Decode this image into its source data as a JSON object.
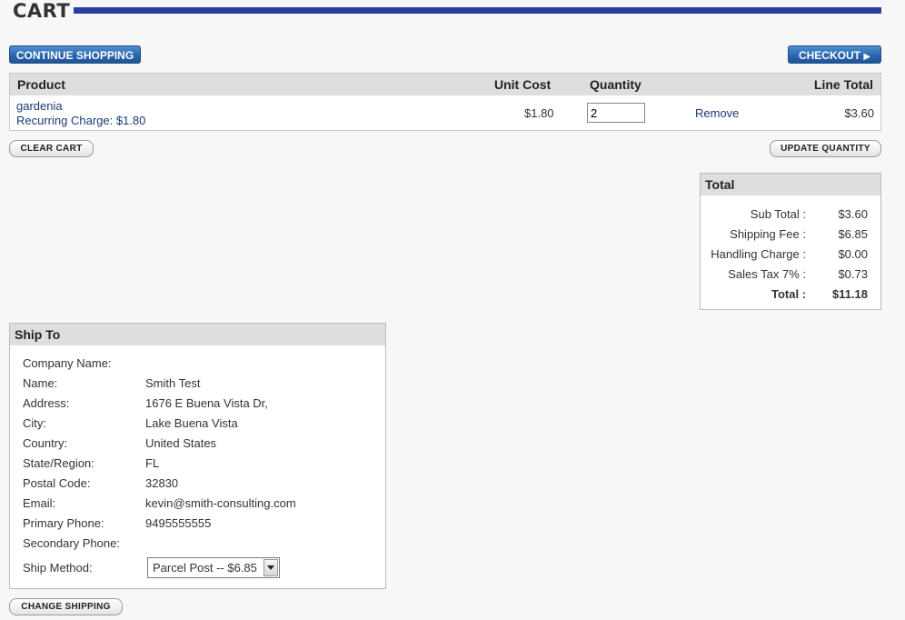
{
  "page": {
    "title": "CART"
  },
  "buttons": {
    "continue_shopping": "CONTINUE SHOPPING",
    "checkout": "CHECKOUT",
    "clear_cart": "CLEAR CART",
    "update_quantity": "UPDATE QUANTITY",
    "change_shipping": "CHANGE SHIPPING"
  },
  "cart": {
    "headers": {
      "product": "Product",
      "unit_cost": "Unit Cost",
      "quantity": "Quantity",
      "line_total": "Line Total"
    },
    "items": [
      {
        "product": "gardenia",
        "recurring": "Recurring Charge: $1.80",
        "unit_cost": "$1.80",
        "quantity": "2",
        "remove": "Remove",
        "line_total": "$3.60"
      }
    ]
  },
  "totals": {
    "heading": "Total",
    "rows": [
      {
        "label": "Sub Total :",
        "value": "$3.60"
      },
      {
        "label": "Shipping Fee :",
        "value": "$6.85"
      },
      {
        "label": "Handling Charge :",
        "value": "$0.00"
      },
      {
        "label": "Sales Tax 7% :",
        "value": "$0.73"
      },
      {
        "label": "Total :",
        "value": "$11.18"
      }
    ]
  },
  "ship_to": {
    "heading": "Ship To",
    "fields": [
      {
        "label": "Company Name:",
        "value": ""
      },
      {
        "label": "Name:",
        "value": "Smith Test"
      },
      {
        "label": "Address:",
        "value": "1676 E Buena Vista Dr,"
      },
      {
        "label": "City:",
        "value": "Lake Buena Vista"
      },
      {
        "label": "Country:",
        "value": "United States"
      },
      {
        "label": "State/Region:",
        "value": "FL"
      },
      {
        "label": "Postal Code:",
        "value": "32830"
      },
      {
        "label": "Email:",
        "value": "kevin@smith-consulting.com"
      },
      {
        "label": "Primary Phone:",
        "value": "9495555555"
      },
      {
        "label": "Secondary Phone:",
        "value": ""
      }
    ],
    "ship_method_label": "Ship Method:",
    "ship_method_value": "Parcel Post -- $6.85"
  },
  "colors": {
    "accent_bar": "#2a3e9e",
    "button_blue": "#2a66ad",
    "link": "#1a3a78"
  }
}
